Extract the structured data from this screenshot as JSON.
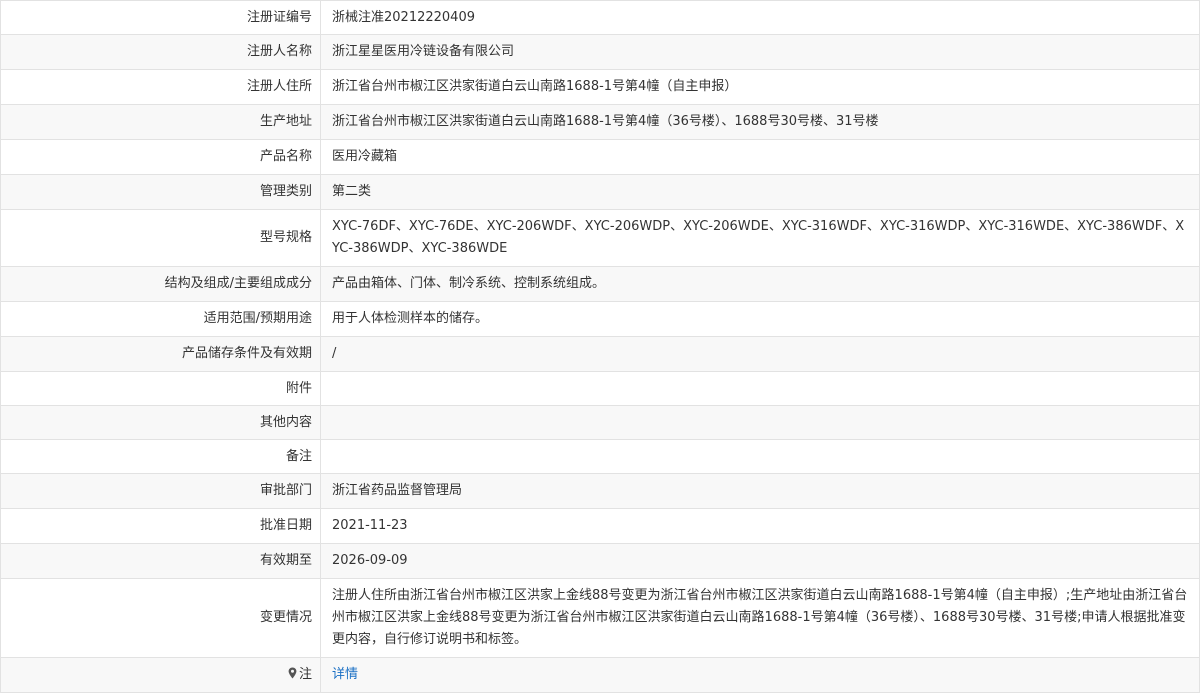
{
  "rows": [
    {
      "label": "注册证编号",
      "value": "浙械注准20212220409"
    },
    {
      "label": "注册人名称",
      "value": "浙江星星医用冷链设备有限公司"
    },
    {
      "label": "注册人住所",
      "value": "浙江省台州市椒江区洪家街道白云山南路1688-1号第4幢（自主申报）"
    },
    {
      "label": "生产地址",
      "value": "浙江省台州市椒江区洪家街道白云山南路1688-1号第4幢（36号楼）、1688号30号楼、31号楼"
    },
    {
      "label": "产品名称",
      "value": "医用冷藏箱"
    },
    {
      "label": "管理类别",
      "value": "第二类"
    },
    {
      "label": "型号规格",
      "value": "XYC-76DF、XYC-76DE、XYC-206WDF、XYC-206WDP、XYC-206WDE、XYC-316WDF、XYC-316WDP、XYC-316WDE、XYC-386WDF、XYC-386WDP、XYC-386WDE"
    },
    {
      "label": "结构及组成/主要组成成分",
      "value": "产品由箱体、门体、制冷系统、控制系统组成。"
    },
    {
      "label": "适用范围/预期用途",
      "value": "用于人体检测样本的储存。"
    },
    {
      "label": "产品储存条件及有效期",
      "value": "/"
    },
    {
      "label": "附件",
      "value": ""
    },
    {
      "label": "其他内容",
      "value": ""
    },
    {
      "label": "备注",
      "value": ""
    },
    {
      "label": "审批部门",
      "value": "浙江省药品监督管理局"
    },
    {
      "label": "批准日期",
      "value": "2021-11-23"
    },
    {
      "label": "有效期至",
      "value": "2026-09-09"
    },
    {
      "label": "变更情况",
      "value": "注册人住所由浙江省台州市椒江区洪家上金线88号变更为浙江省台州市椒江区洪家街道白云山南路1688-1号第4幢（自主申报）;生产地址由浙江省台州市椒江区洪家上金线88号变更为浙江省台州市椒江区洪家街道白云山南路1688-1号第4幢（36号楼）、1688号30号楼、31号楼;申请人根据批准变更内容，自行修订说明书和标签。"
    }
  ],
  "note": {
    "label": "注",
    "icon": "location-pin-icon",
    "link_text": "详情",
    "link_color": "#1a6fc4"
  }
}
